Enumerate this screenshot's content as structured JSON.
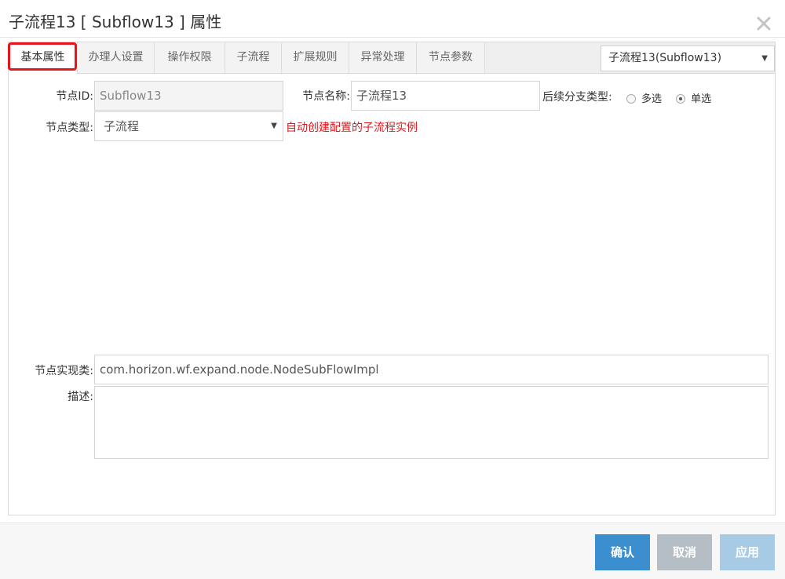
{
  "dialog": {
    "title": "子流程13 [ Subflow13 ] 属性",
    "close_icon": "close-icon"
  },
  "tabs": [
    {
      "label": "基本属性",
      "active": true
    },
    {
      "label": "办理人设置",
      "active": false
    },
    {
      "label": "操作权限",
      "active": false
    },
    {
      "label": "子流程",
      "active": false
    },
    {
      "label": "扩展规则",
      "active": false
    },
    {
      "label": "异常处理",
      "active": false
    },
    {
      "label": "节点参数",
      "active": false
    }
  ],
  "node_selector": {
    "value": "子流程13(Subflow13)"
  },
  "form": {
    "node_id_label": "节点ID:",
    "node_id_value": "Subflow13",
    "node_name_label": "节点名称:",
    "node_name_value": "子流程13",
    "branch_type_label": "后续分支类型:",
    "branch_options": [
      {
        "label": "多选",
        "checked": false
      },
      {
        "label": "单选",
        "checked": true
      }
    ],
    "node_type_label": "节点类型:",
    "node_type_value": "子流程",
    "node_type_hint": "自动创建配置的子流程实例",
    "impl_class_label": "节点实现类:",
    "impl_class_value": "com.horizon.wf.expand.node.NodeSubFlowImpl",
    "description_label": "描述:",
    "description_value": ""
  },
  "footer": {
    "confirm_label": "确认",
    "cancel_label": "取消",
    "apply_label": "应用"
  },
  "colors": {
    "highlight": "#e8141c",
    "hint": "#e4161b",
    "confirm_button": "#3c8fcf",
    "cancel_button": "#b5bec5",
    "apply_button": "#a8cbe5"
  }
}
